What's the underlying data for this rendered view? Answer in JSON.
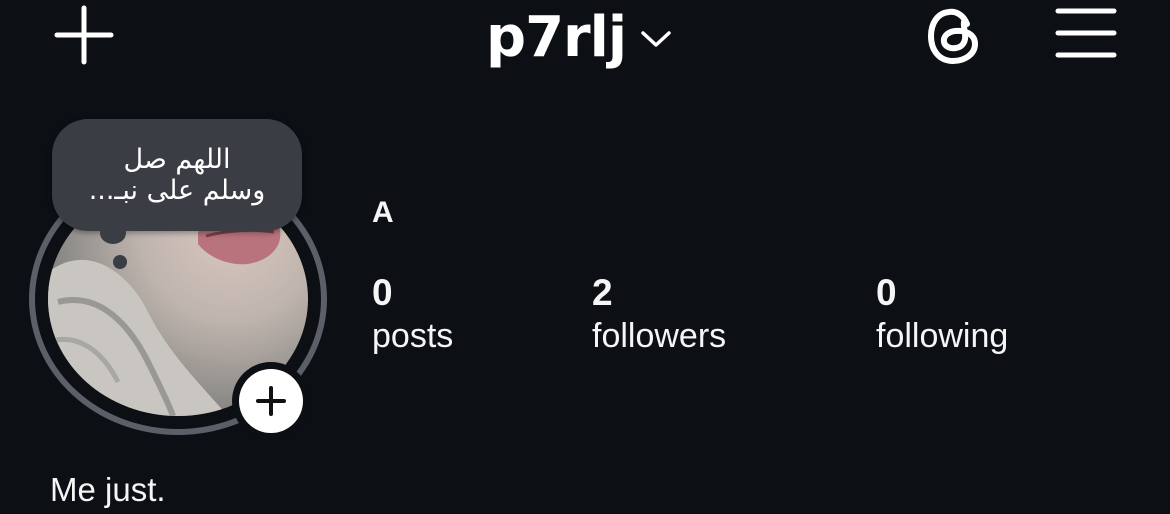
{
  "header": {
    "username": "p7rlj",
    "new_post_icon": "plus-icon",
    "switch_account_icon": "chevron-down-icon",
    "threads_icon": "threads-icon",
    "menu_icon": "hamburger-menu-icon"
  },
  "profile": {
    "note": "اللهم صل\nوسلم على نبـ...",
    "display_name": "A",
    "add_story_icon": "plus-icon",
    "bio": "Me just."
  },
  "stats": {
    "posts": {
      "count": "0",
      "label": "posts"
    },
    "followers": {
      "count": "2",
      "label": "followers"
    },
    "following": {
      "count": "0",
      "label": "following"
    }
  },
  "colors": {
    "background": "#0c0f14",
    "ring": "#5a5f68",
    "bubble": "#3a3d44",
    "text": "#f5f5f5"
  }
}
